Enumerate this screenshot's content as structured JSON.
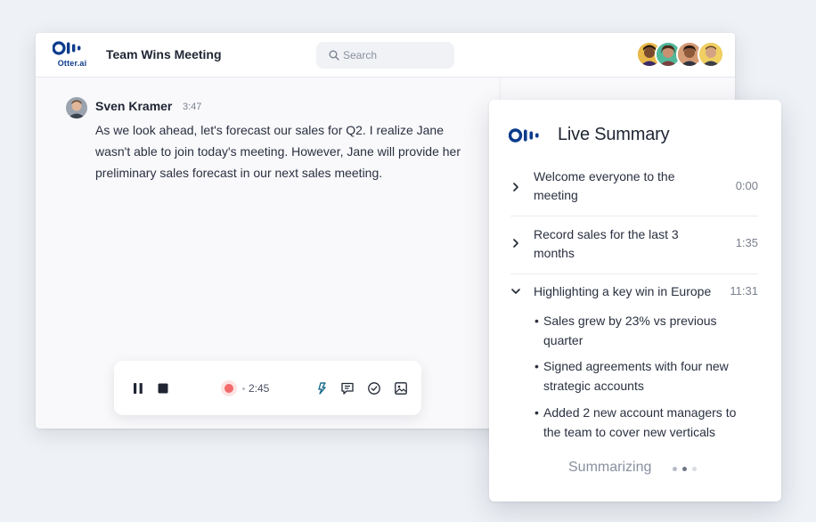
{
  "app": {
    "logo_text": "Otter.ai",
    "meeting_title": "Team Wins Meeting",
    "brand_color": "#0b3b8c"
  },
  "search": {
    "placeholder": "Search",
    "icon": "search-icon"
  },
  "participants": [
    {
      "name": "participant-1"
    },
    {
      "name": "participant-2"
    },
    {
      "name": "participant-3"
    },
    {
      "name": "participant-4"
    }
  ],
  "transcript": {
    "speaker": "Sven Kramer",
    "time": "3:47",
    "text": "As we look ahead, let's forecast our sales for Q2. I realize Jane wasn't able to join today's meeting. However, Jane will provide her preliminary sales forecast in our next sales meeting."
  },
  "recorder": {
    "elapsed": "2:45",
    "pause_icon": "pause-icon",
    "stop_icon": "stop-icon",
    "icons": [
      "highlight-icon",
      "comment-icon",
      "check-circle-icon",
      "image-icon"
    ],
    "record_color": "#f26a6a"
  },
  "live_summary": {
    "title": "Live Summary",
    "items": [
      {
        "label": "Welcome everyone to the meeting",
        "time": "0:00",
        "expanded": false
      },
      {
        "label": "Record sales for the last 3 months",
        "time": "1:35",
        "expanded": false
      },
      {
        "label": "Highlighting a key win in Europe",
        "time": "11:31",
        "expanded": true,
        "bullets": [
          "Sales grew by 23% vs previous quarter",
          "Signed agreements with four new strategic accounts",
          "Added 2 new account managers to the team to cover new verticals"
        ]
      }
    ],
    "status": "Summarizing"
  }
}
